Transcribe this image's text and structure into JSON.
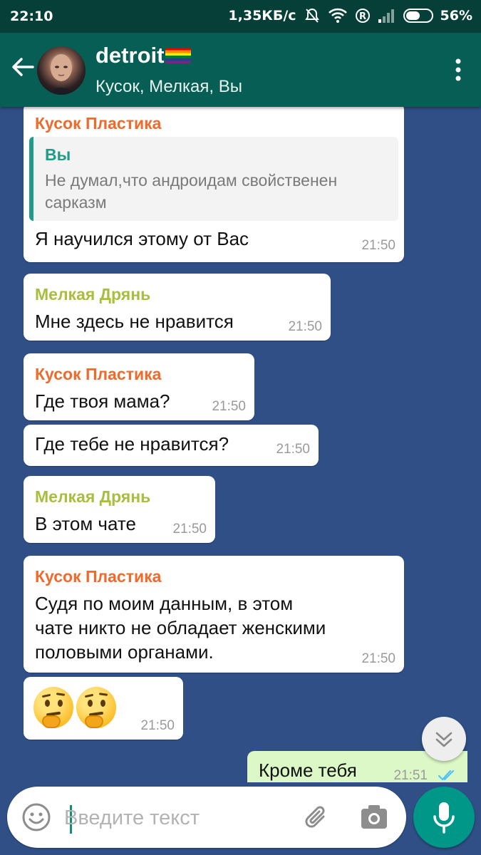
{
  "status_bar": {
    "time": "22:10",
    "speed": "1,35КБ/с",
    "battery_label": "56%",
    "battery_level": 0.56
  },
  "header": {
    "title": "detroit",
    "subtitle": "Кусок, Мелкая, Вы",
    "icons": [
      "back-arrow-icon",
      "avatar",
      "rainbow-flag-icon",
      "overflow-menu-icon"
    ]
  },
  "messages": [
    {
      "sender": "Кусок Пластика",
      "quote_name": "Вы",
      "quote_text": "Не думал,что андроидам свойственен сарказм",
      "text": "Я научился этому от Вас",
      "time": "21:50"
    },
    {
      "sender": "Мелкая Дрянь",
      "text": "Мне здесь не нравится",
      "time": "21:50"
    },
    {
      "sender": "Кусок Пластика",
      "text": "Где твоя мама?",
      "time": "21:50"
    },
    {
      "text": "Где тебе не нравится?",
      "time": "21:50"
    },
    {
      "sender": "Мелкая Дрянь",
      "text": "В этом чате",
      "time": "21:50"
    },
    {
      "sender": "Кусок Пластика",
      "text_lines": [
        "Судя по моим данным, в этом",
        "чате никто не обладает женскими",
        "половыми органами."
      ],
      "time": "21:50"
    },
    {
      "emoji": "thinking-face-emoji x2",
      "time": "21:50"
    },
    {
      "outgoing": true,
      "text": "Кроме тебя",
      "time": "21:51",
      "status": "read-double-check"
    }
  ],
  "input": {
    "placeholder": "Введите текст",
    "value": ""
  },
  "colors": {
    "status_bar": "#053f37",
    "header": "#075e54",
    "chat_background": "#2f4f86",
    "sender_orange": "#f06a2b",
    "sender_green": "#a9be3e",
    "outgoing_bubble": "#dcf8c6",
    "accent": "#009688"
  }
}
